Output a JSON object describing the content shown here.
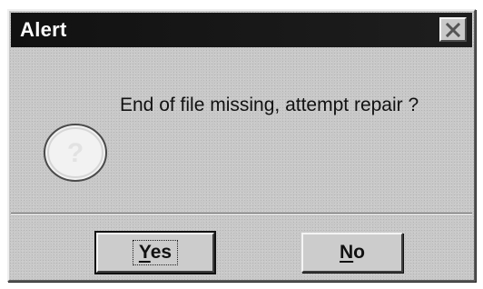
{
  "dialog": {
    "title": "Alert",
    "close_icon": "close-icon",
    "message": "End of file missing, attempt repair ?",
    "icon": "question-icon",
    "buttons": {
      "yes": {
        "mnemonic": "Y",
        "rest": "es"
      },
      "no": {
        "mnemonic": "N",
        "rest": "o"
      }
    }
  }
}
